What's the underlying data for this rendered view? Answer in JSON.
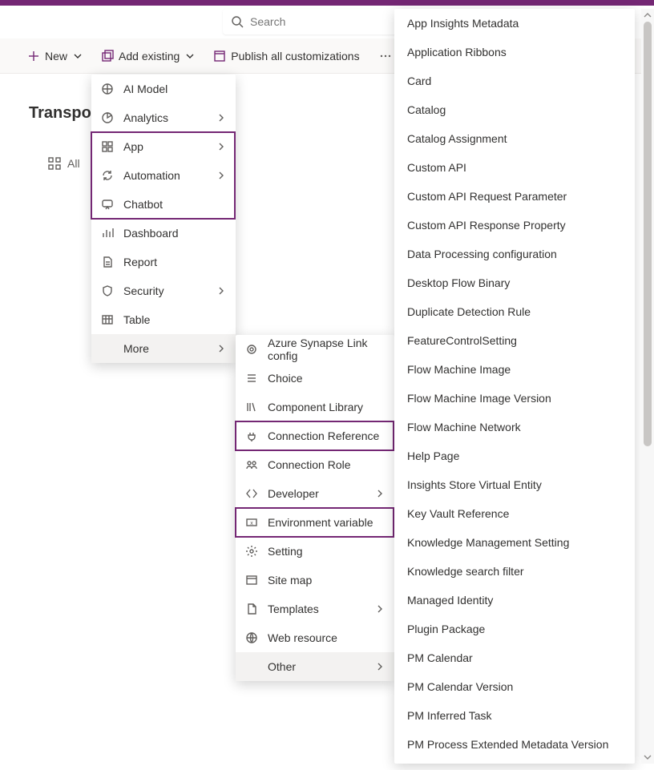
{
  "search": {
    "placeholder": "Search"
  },
  "toolbar": {
    "new_label": "New",
    "add_existing_label": "Add existing",
    "publish_label": "Publish all customizations"
  },
  "page": {
    "title_visible": "Transport",
    "all_label": "All"
  },
  "menu1": [
    {
      "label": "AI Model",
      "icon": "ai-model-icon",
      "arrow": false
    },
    {
      "label": "Analytics",
      "icon": "analytics-icon",
      "arrow": true
    },
    {
      "label": "App",
      "icon": "app-icon",
      "arrow": true
    },
    {
      "label": "Automation",
      "icon": "automation-icon",
      "arrow": true
    },
    {
      "label": "Chatbot",
      "icon": "chatbot-icon",
      "arrow": false
    },
    {
      "label": "Dashboard",
      "icon": "dashboard-icon",
      "arrow": false
    },
    {
      "label": "Report",
      "icon": "report-icon",
      "arrow": false
    },
    {
      "label": "Security",
      "icon": "security-icon",
      "arrow": true
    },
    {
      "label": "Table",
      "icon": "table-icon",
      "arrow": false
    },
    {
      "label": "More",
      "icon": "",
      "arrow": true,
      "hovered": true
    }
  ],
  "menu2": [
    {
      "label": "Azure Synapse Link config",
      "icon": "synapse-icon",
      "arrow": false
    },
    {
      "label": "Choice",
      "icon": "choice-icon",
      "arrow": false
    },
    {
      "label": "Component Library",
      "icon": "library-icon",
      "arrow": false
    },
    {
      "label": "Connection Reference",
      "icon": "plug-icon",
      "arrow": false
    },
    {
      "label": "Connection Role",
      "icon": "conn-role-icon",
      "arrow": false
    },
    {
      "label": "Developer",
      "icon": "developer-icon",
      "arrow": true
    },
    {
      "label": "Environment variable",
      "icon": "env-var-icon",
      "arrow": false
    },
    {
      "label": "Setting",
      "icon": "setting-icon",
      "arrow": false
    },
    {
      "label": "Site map",
      "icon": "sitemap-icon",
      "arrow": false
    },
    {
      "label": "Templates",
      "icon": "templates-icon",
      "arrow": true
    },
    {
      "label": "Web resource",
      "icon": "web-resource-icon",
      "arrow": false
    },
    {
      "label": "Other",
      "icon": "",
      "arrow": true,
      "hovered": true
    }
  ],
  "menu3": [
    "App Insights Metadata",
    "Application Ribbons",
    "Card",
    "Catalog",
    "Catalog Assignment",
    "Custom API",
    "Custom API Request Parameter",
    "Custom API Response Property",
    "Data Processing configuration",
    "Desktop Flow Binary",
    "Duplicate Detection Rule",
    "FeatureControlSetting",
    "Flow Machine Image",
    "Flow Machine Image Version",
    "Flow Machine Network",
    "Help Page",
    "Insights Store Virtual Entity",
    "Key Vault Reference",
    "Knowledge Management Setting",
    "Knowledge search filter",
    "Managed Identity",
    "Plugin Package",
    "PM Calendar",
    "PM Calendar Version",
    "PM Inferred Task",
    "PM Process Extended Metadata Version"
  ]
}
